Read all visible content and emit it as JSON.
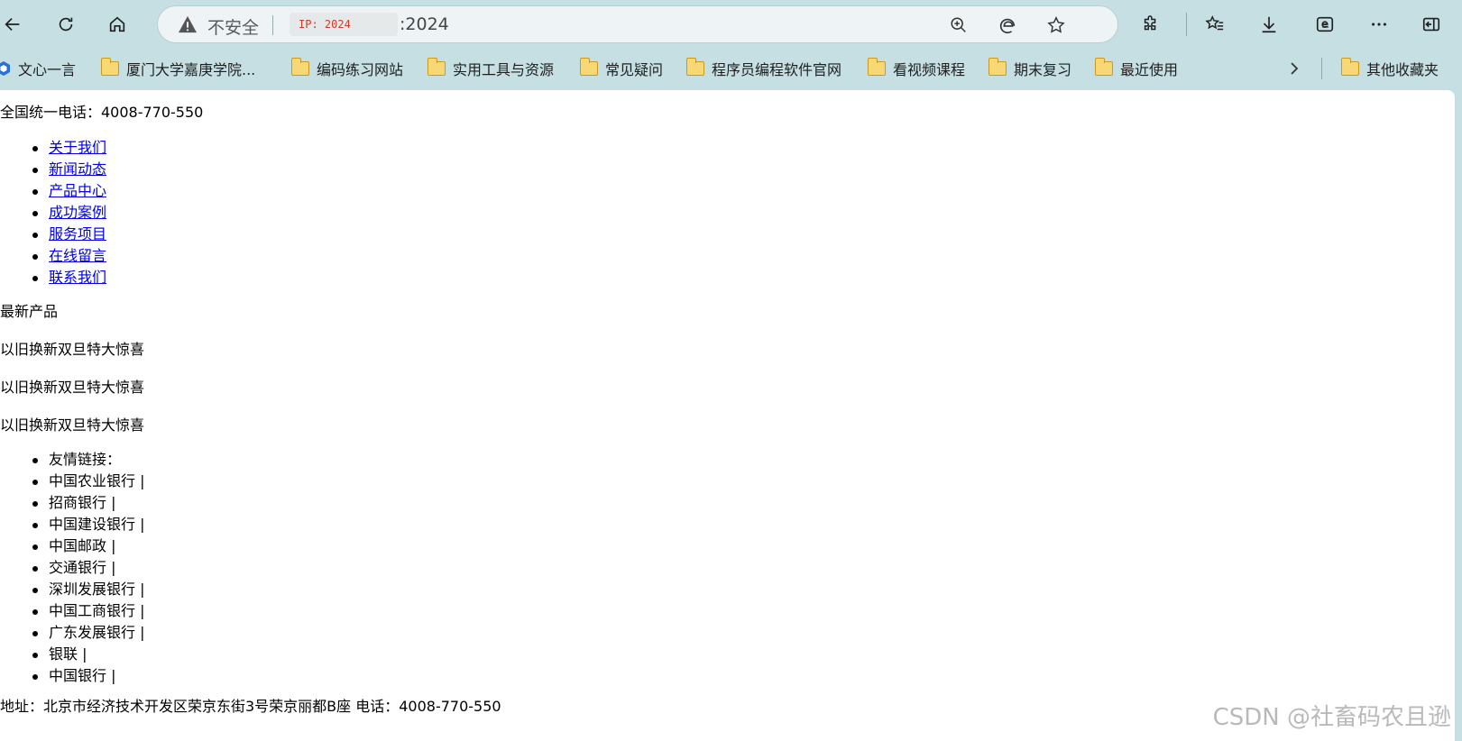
{
  "browser": {
    "security_label": "不安全",
    "ip_badge": "IP: 2024",
    "address_port": ":2024"
  },
  "bookmarks": [
    {
      "label": "文心一言",
      "icon": "wenxin-icon"
    },
    {
      "label": "厦门大学嘉庚学院...",
      "icon": "folder-icon"
    },
    {
      "label": "编码练习网站",
      "icon": "folder-icon"
    },
    {
      "label": "实用工具与资源",
      "icon": "folder-icon"
    },
    {
      "label": "常见疑问",
      "icon": "folder-icon"
    },
    {
      "label": "程序员编程软件官网",
      "icon": "folder-icon"
    },
    {
      "label": "看视频课程",
      "icon": "folder-icon"
    },
    {
      "label": "期末复习",
      "icon": "folder-icon"
    },
    {
      "label": "最近使用",
      "icon": "folder-icon"
    }
  ],
  "other_bookmarks": "其他收藏夹",
  "page": {
    "phone_line": "全国统一电话：4008-770-550",
    "nav_links": [
      "关于我们",
      "新闻动态",
      "产品中心",
      "成功案例",
      "服务项目",
      "在线留言",
      "联系我们"
    ],
    "products_heading": "最新产品",
    "promos": [
      "以旧换新双旦特大惊喜",
      "以旧换新双旦特大惊喜",
      "以旧换新双旦特大惊喜"
    ],
    "friend_links": [
      "友情链接：",
      "中国农业银行 |",
      "招商银行 |",
      "中国建设银行 |",
      "中国邮政 |",
      "交通银行 |",
      "深圳发展银行 |",
      "中国工商银行 |",
      "广东发展银行 |",
      "银联 |",
      "中国银行 |"
    ],
    "address_line": "地址：北京市经济技术开发区荣京东街3号荣京丽都B座 电话：4008-770-550"
  },
  "watermark": "CSDN @社畜码农且逊"
}
